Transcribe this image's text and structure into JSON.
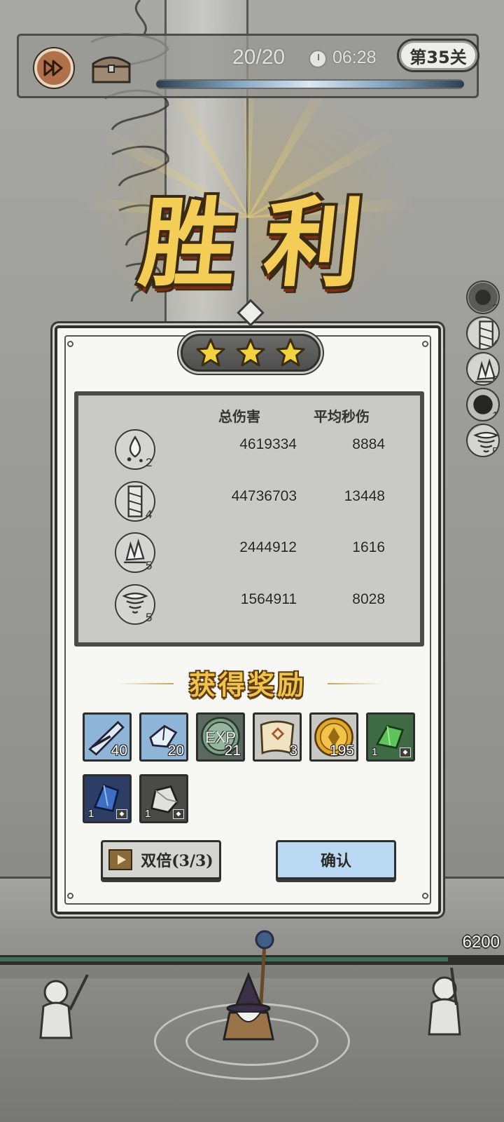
{
  "hud": {
    "wave": "20/20",
    "timer": "06:28",
    "level": "第35关",
    "level_progress": 1.0,
    "speed_icon": "fast-forward-icon",
    "chest_icon": "treasure-chest-icon"
  },
  "victory_title": "胜利",
  "stars": {
    "earned": 3,
    "total": 3
  },
  "stats": {
    "header_damage": "总伤害",
    "header_dps": "平均秒伤",
    "rows": [
      {
        "icon": "water-drop-skill-icon",
        "level": "2",
        "damage": "4619334",
        "dps": "8884"
      },
      {
        "icon": "spiral-pillar-skill-icon",
        "level": "4",
        "damage": "44736703",
        "dps": "13448"
      },
      {
        "icon": "ice-crystal-skill-icon",
        "level": "5",
        "damage": "2444912",
        "dps": "1616"
      },
      {
        "icon": "tornado-skill-icon",
        "level": "5",
        "damage": "1564911",
        "dps": "8028"
      }
    ]
  },
  "side_skills": [
    {
      "icon": "dark-orb-skill-icon",
      "level": "2"
    },
    {
      "icon": "spiral-pillar-skill-icon",
      "level": "4"
    },
    {
      "icon": "ice-crystal-skill-icon",
      "level": "5"
    },
    {
      "icon": "shadow-sphere-skill-icon",
      "level": "1"
    },
    {
      "icon": "tornado-skill-icon",
      "level": "5"
    }
  ],
  "rewards_title": "获得奖励",
  "rewards": [
    {
      "icon": "blue-scroll-icon",
      "qty": "40"
    },
    {
      "icon": "blue-crystal-shard-icon",
      "qty": "20"
    },
    {
      "icon": "exp-orb-icon",
      "qty": "21",
      "label": "EXP"
    },
    {
      "icon": "parchment-scroll-icon",
      "qty": "3"
    },
    {
      "icon": "gold-coin-icon",
      "qty": "195"
    },
    {
      "icon": "green-gem-icon",
      "qty": "1"
    },
    {
      "icon": "blue-gem-icon",
      "qty": "1"
    },
    {
      "icon": "silver-ore-icon",
      "qty": "1"
    }
  ],
  "buttons": {
    "double": "双倍(3/3)",
    "confirm": "确认"
  },
  "player_hp": "6200",
  "colors": {
    "gold_text": "#f3cd55",
    "confirm_button": "#bcd9f4",
    "panel_bg": "#f7f7f4",
    "stats_bg": "#c9c9c6"
  }
}
